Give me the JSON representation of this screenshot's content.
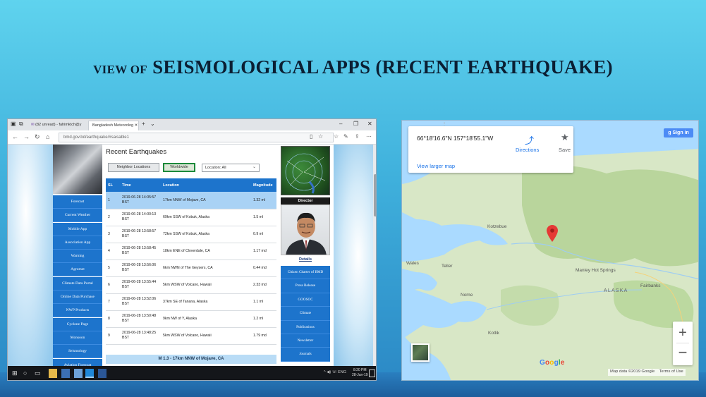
{
  "slide": {
    "title_small": "VIEW OF",
    "title_large": "SEISMOLOGICAL APPS (RECENT EARTHQUAKE)"
  },
  "browser": {
    "tabs": [
      "(82 unread) - fahimktch@y",
      "Bangladesh Meteorolog"
    ],
    "url": "bmd.gov.bd/earthquake/#saisable1",
    "toolbar_icons": [
      "reading-view-icon",
      "favorite-star-icon",
      "favorites-hub-icon",
      "pen-icon",
      "share-icon",
      "more-icon"
    ]
  },
  "sidenav": [
    "Forecast",
    "Current Weather",
    "Mobile App",
    "Association App",
    "Warning",
    "Agromet",
    "Climate Data Portal",
    "Online Data Purchase",
    "NWP Products",
    "Cyclone Page",
    "Monsoon",
    "Seismology",
    "Aviation Forecast"
  ],
  "earthquakes": {
    "title": "Recent Earthquakes",
    "filters": {
      "neighbor": "Neighbor Locations",
      "worldwide": "Worldwide",
      "location": "Location: All"
    },
    "columns": [
      "SL",
      "Time",
      "Location",
      "Magnitude"
    ],
    "rows": [
      {
        "sl": "1",
        "time": "2019-06-28 14:05:57",
        "tz": "BST",
        "location": "17km NNW of Mojave, CA",
        "mag": "1.32 ml"
      },
      {
        "sl": "2",
        "time": "2019-06-28 14:00:13",
        "tz": "BST",
        "location": "69km SSW of Kobuk, Alaska",
        "mag": "1.5 ml"
      },
      {
        "sl": "3",
        "time": "2019-06-28 13:58:57",
        "tz": "BST",
        "location": "72km SSW of Kobuk, Alaska",
        "mag": "0.9 ml"
      },
      {
        "sl": "4",
        "time": "2019-06-28 13:58:45",
        "tz": "BST",
        "location": "18km ENE of Cloverdale, CA",
        "mag": "1.17 md"
      },
      {
        "sl": "5",
        "time": "2019-06-28 13:56:06",
        "tz": "BST",
        "location": "6km NWN of The Geysers, CA",
        "mag": "0.44 md"
      },
      {
        "sl": "6",
        "time": "2019-06-28 13:55:44",
        "tz": "BST",
        "location": "5km WSW of Volcano, Hawaii",
        "mag": "2.33 md"
      },
      {
        "sl": "7",
        "time": "2019-06-28 13:52:06",
        "tz": "BST",
        "location": "37km SE of Tanana, Alaska",
        "mag": "1.1 ml"
      },
      {
        "sl": "8",
        "time": "2019-06-28 13:50:48",
        "tz": "BST",
        "location": "9km NW of Y, Alaska",
        "mag": "1.2 ml"
      },
      {
        "sl": "9",
        "time": "2019-06-28 13:48:25",
        "tz": "BST",
        "location": "5km WSW of Volcano, Hawaii",
        "mag": "1.79 md"
      }
    ],
    "banner": "M 1.3 - 17km NNW of Mojave, CA"
  },
  "rightpanel": {
    "director": "Director",
    "details": "Details",
    "links": [
      "Citizen Charter of BMD",
      "Press Release",
      "GOOSOC",
      "Climate",
      "Publications",
      "Newsletter",
      "Journals"
    ]
  },
  "taskbar": {
    "time": "8:20 PM",
    "date": "28-Jun-19",
    "tray": "^ ◀) ☏ ENG"
  },
  "map": {
    "coords": "66°18'16.6\"N 157°18'55.1\"W",
    "directions": "Directions",
    "save": "Save",
    "larger_map": "View larger map",
    "signin": "Sign in",
    "places": [
      "Kotzebue",
      "Nome",
      "ALASKA",
      "Fairbanks",
      "Wales",
      "Teller",
      "Kotlik",
      "Manley Hot Springs"
    ],
    "google": [
      "G",
      "o",
      "o",
      "g",
      "l",
      "e"
    ],
    "footer_data": "Map data ©2019 Google",
    "footer_terms": "Terms of Use",
    "colors": {
      "land": "#d8e7c6",
      "forest": "#b9d59c",
      "water": "#aadaff",
      "pin": "#e53935",
      "google_blue": "#4285F4",
      "google_red": "#EA4335",
      "google_yellow": "#FBBC05",
      "google_green": "#34A853"
    }
  }
}
